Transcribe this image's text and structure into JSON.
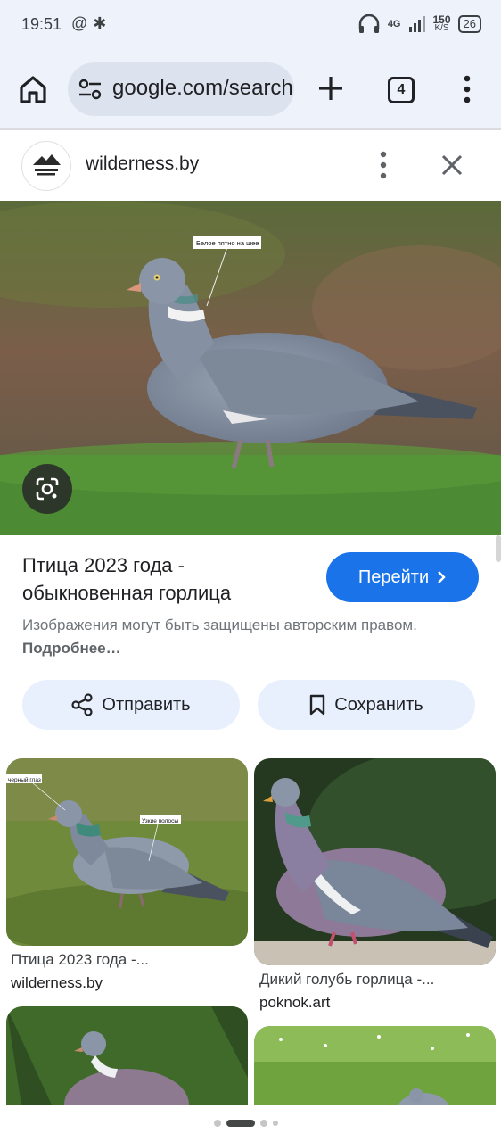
{
  "status_bar": {
    "time": "19:51",
    "left_icons": [
      "threads-icon",
      "pinwheel-icon"
    ],
    "network": "4G",
    "speed_top": "150",
    "speed_bottom": "K/S",
    "battery": "26"
  },
  "toolbar": {
    "url": "google.com/search",
    "tab_count": "4"
  },
  "site": {
    "name": "wilderness.by",
    "logo_text": "Дзікая прырода"
  },
  "hero": {
    "annotation": "Белое пятно на шее"
  },
  "result": {
    "title": "Птица 2023 года - обыкновенная горлица",
    "go_label": "Перейти",
    "copyright_text": "Изображения могут быть защищены авторским правом.",
    "more_link": "Подробнее…",
    "share_label": "Отправить",
    "save_label": "Сохранить"
  },
  "related": [
    {
      "title": "Птица 2023 года -...",
      "source": "wilderness.by",
      "annot_1": "черный глаз",
      "annot_2": "Узкие полосы"
    },
    {
      "title": "Дикий голубь горлица -...",
      "source": "poknok.art"
    }
  ],
  "colors": {
    "accent": "#1a73e8",
    "toolbar_bg": "#eef2fa",
    "pill_bg": "#e8f0fe"
  }
}
